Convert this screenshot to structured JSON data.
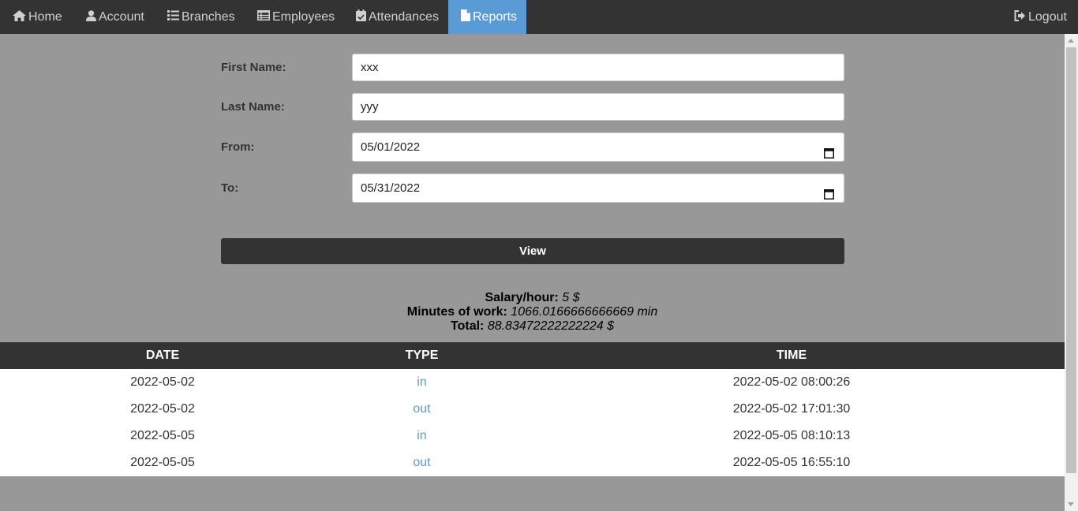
{
  "nav": {
    "items": [
      {
        "label": "Home",
        "icon": "home-icon"
      },
      {
        "label": "Account",
        "icon": "user-icon"
      },
      {
        "label": "Branches",
        "icon": "list-icon"
      },
      {
        "label": "Employees",
        "icon": "table-icon"
      },
      {
        "label": "Attendances",
        "icon": "calendar-check-icon"
      },
      {
        "label": "Reports",
        "icon": "file-icon",
        "active": true
      }
    ],
    "logout_label": "Logout"
  },
  "form": {
    "first_name_label": "First Name:",
    "first_name_value": "xxx",
    "last_name_label": "Last Name:",
    "last_name_value": "yyy",
    "from_label": "From:",
    "from_value": "05/01/2022",
    "to_label": "To:",
    "to_value": "05/31/2022",
    "view_label": "View"
  },
  "summary": {
    "salary_label": "Salary/hour:",
    "salary_value": "5 $",
    "minutes_label": "Minutes of work:",
    "minutes_value": "1066.0166666666669 min",
    "total_label": "Total:",
    "total_value": "88.83472222222224 $"
  },
  "table": {
    "headers": [
      "DATE",
      "TYPE",
      "TIME"
    ],
    "rows": [
      {
        "date": "2022-05-02",
        "type": "in",
        "time": "2022-05-02 08:00:26"
      },
      {
        "date": "2022-05-02",
        "type": "out",
        "time": "2022-05-02 17:01:30"
      },
      {
        "date": "2022-05-05",
        "type": "in",
        "time": "2022-05-05 08:10:13"
      },
      {
        "date": "2022-05-05",
        "type": "out",
        "time": "2022-05-05 16:55:10"
      }
    ]
  },
  "colors": {
    "navbar": "#333333",
    "active_tab": "#5b9bd5",
    "page_background": "#989898",
    "link": "#5b9bd5"
  }
}
